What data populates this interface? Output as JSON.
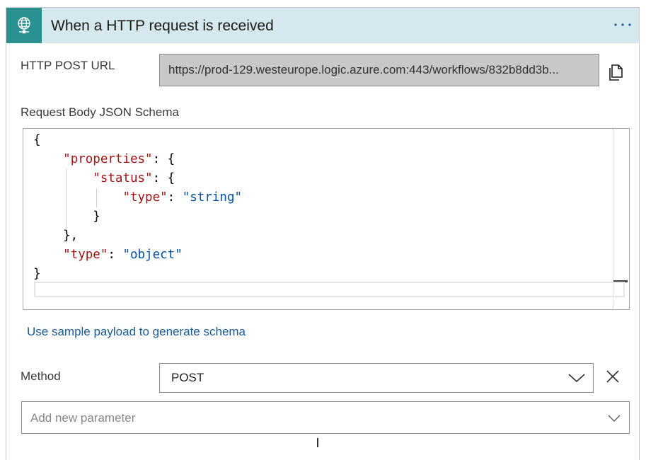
{
  "header": {
    "title": "When a HTTP request is received",
    "icon": "globe-network-icon",
    "icon_bg": "#2a9090",
    "bg": "#d4e8ed",
    "more_icon": "ellipsis-icon"
  },
  "http_post_url": {
    "label": "HTTP POST URL",
    "value": "https://prod-129.westeurope.logic.azure.com:443/workflows/832b8dd3b...",
    "copy_icon": "copy-icon"
  },
  "schema": {
    "label": "Request Body JSON Schema",
    "lines": [
      [
        "{"
      ],
      [
        "    ",
        {
          "k": "\"properties\""
        },
        ": {"
      ],
      [
        "        ",
        {
          "k": "\"status\""
        },
        ": {"
      ],
      [
        "            ",
        {
          "k": "\"type\""
        },
        ": ",
        {
          "s": "\"string\""
        }
      ],
      [
        "        }"
      ],
      [
        "    },"
      ],
      [
        "    ",
        {
          "k": "\"type\""
        },
        ": ",
        {
          "s": "\"object\""
        }
      ],
      [
        "}"
      ]
    ],
    "key_color": "#a31515",
    "string_color": "#0451a5"
  },
  "sample_payload_link": "Use sample payload to generate schema",
  "method": {
    "label": "Method",
    "value": "POST",
    "chevron_icon": "chevron-down-icon",
    "remove_icon": "close-icon"
  },
  "add_parameter": {
    "placeholder": "Add new parameter",
    "chevron_icon": "chevron-down-icon"
  },
  "colors": {
    "link": "#1a5a96"
  }
}
